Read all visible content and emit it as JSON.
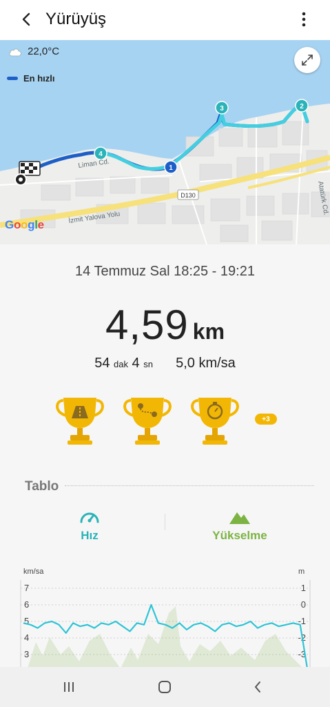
{
  "app": {
    "title": "Yürüyüş"
  },
  "map": {
    "temperature": "22,0°C",
    "legend_label": "En hızlı",
    "roads": {
      "liman": "Liman Cd.",
      "izmit": "İzmit Yalova Yolu",
      "d130": "D130",
      "ataturk": "Atatürk Cd."
    },
    "markers": [
      "1",
      "2",
      "3",
      "4"
    ],
    "attribution": "Google"
  },
  "summary": {
    "date_range": "14 Temmuz Sal 18:25 - 19:21",
    "distance_value": "4,59",
    "distance_unit": "km",
    "duration_min": "54",
    "duration_min_unit": "dak",
    "duration_sec": "4",
    "duration_sec_unit": "sn",
    "avg_speed": "5,0 km/sa",
    "trophies": [
      "distance-trophy",
      "route-trophy",
      "stopwatch-trophy"
    ],
    "more_trophies": "+3"
  },
  "table": {
    "title": "Tablo",
    "tabs": [
      {
        "label": "Hız",
        "color": "#2ab3b8"
      },
      {
        "label": "Yükselme",
        "color": "#7cb342"
      }
    ]
  },
  "chart_data": {
    "type": "line",
    "left_axis": {
      "unit": "km/sa",
      "ticks": [
        "7",
        "6",
        "5",
        "4",
        "3"
      ]
    },
    "right_axis": {
      "unit": "m",
      "ticks": [
        "1",
        "0",
        "-1",
        "-2",
        "-3"
      ]
    },
    "series": [
      {
        "values": [
          4.9,
          4.8,
          4.6,
          4.9,
          5.0,
          4.8,
          4.3,
          4.9,
          4.7,
          4.8,
          4.6,
          4.9,
          4.8,
          5.0,
          4.7,
          4.4,
          4.9,
          4.8,
          6.0,
          4.9,
          4.8,
          4.6,
          4.9,
          4.5,
          4.8,
          4.9,
          4.7,
          4.4,
          4.8,
          4.9,
          4.7,
          4.8,
          5.0,
          4.6,
          4.8,
          4.9,
          4.7,
          4.8,
          4.9,
          4.8,
          0
        ]
      }
    ]
  },
  "nav": {
    "recent": "recent-apps",
    "home": "home",
    "back": "back"
  }
}
